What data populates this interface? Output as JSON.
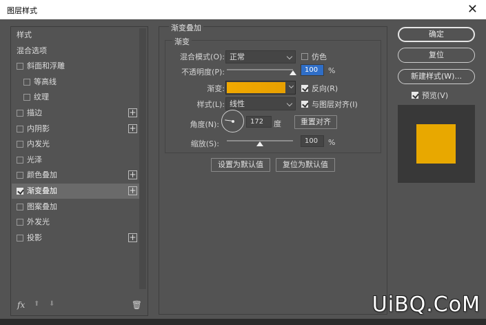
{
  "window": {
    "title": "图层样式",
    "close_glyph": "✕"
  },
  "sidebar": {
    "items": [
      {
        "label": "样式",
        "checkbox": false,
        "checked": false,
        "plus": false,
        "indent": false,
        "selected": false
      },
      {
        "label": "混合选项",
        "checkbox": false,
        "checked": false,
        "plus": false,
        "indent": false,
        "selected": false
      },
      {
        "label": "斜面和浮雕",
        "checkbox": true,
        "checked": false,
        "plus": false,
        "indent": false,
        "selected": false
      },
      {
        "label": "等高线",
        "checkbox": true,
        "checked": false,
        "plus": false,
        "indent": true,
        "selected": false
      },
      {
        "label": "纹理",
        "checkbox": true,
        "checked": false,
        "plus": false,
        "indent": true,
        "selected": false
      },
      {
        "label": "描边",
        "checkbox": true,
        "checked": false,
        "plus": true,
        "indent": false,
        "selected": false
      },
      {
        "label": "内阴影",
        "checkbox": true,
        "checked": false,
        "plus": true,
        "indent": false,
        "selected": false
      },
      {
        "label": "内发光",
        "checkbox": true,
        "checked": false,
        "plus": false,
        "indent": false,
        "selected": false
      },
      {
        "label": "光泽",
        "checkbox": true,
        "checked": false,
        "plus": false,
        "indent": false,
        "selected": false
      },
      {
        "label": "颜色叠加",
        "checkbox": true,
        "checked": false,
        "plus": true,
        "indent": false,
        "selected": false
      },
      {
        "label": "渐变叠加",
        "checkbox": true,
        "checked": true,
        "plus": true,
        "indent": false,
        "selected": true
      },
      {
        "label": "图案叠加",
        "checkbox": true,
        "checked": false,
        "plus": false,
        "indent": false,
        "selected": false
      },
      {
        "label": "外发光",
        "checkbox": true,
        "checked": false,
        "plus": false,
        "indent": false,
        "selected": false
      },
      {
        "label": "投影",
        "checkbox": true,
        "checked": false,
        "plus": true,
        "indent": false,
        "selected": false
      }
    ],
    "footer": {
      "fx": "fx",
      "up": "⬆",
      "down": "⬇",
      "trash": "🗑"
    }
  },
  "panel": {
    "section_title": "渐变叠加",
    "group_title": "渐变",
    "blend_mode": {
      "label": "混合模式(O):",
      "value": "正常"
    },
    "dither": {
      "label": "仿色",
      "checked": false
    },
    "opacity": {
      "label": "不透明度(P):",
      "value": "100",
      "unit": "%",
      "level": 1.0
    },
    "gradient": {
      "label": "渐变:",
      "color_left": "#f0a800",
      "color_right": "#e8a000"
    },
    "reverse": {
      "label": "反向(R)",
      "checked": true
    },
    "style": {
      "label": "样式(L):",
      "value": "线性"
    },
    "align_layer": {
      "label": "与图层对齐(I)",
      "checked": true
    },
    "angle": {
      "label": "角度(N):",
      "value": "172",
      "unit": "度",
      "degrees": 172
    },
    "reset_align": "重置对齐",
    "scale": {
      "label": "缩放(S):",
      "value": "100",
      "unit": "%",
      "level": 0.5
    },
    "set_default": "设置为默认值",
    "reset_default": "复位为默认值"
  },
  "right": {
    "ok": "确定",
    "reset": "复位",
    "new_style": "新建样式(W)...",
    "preview": {
      "label": "预览(V)",
      "checked": true
    },
    "preview_color": "#e8a800"
  },
  "watermark": "UiBQ.CoM"
}
